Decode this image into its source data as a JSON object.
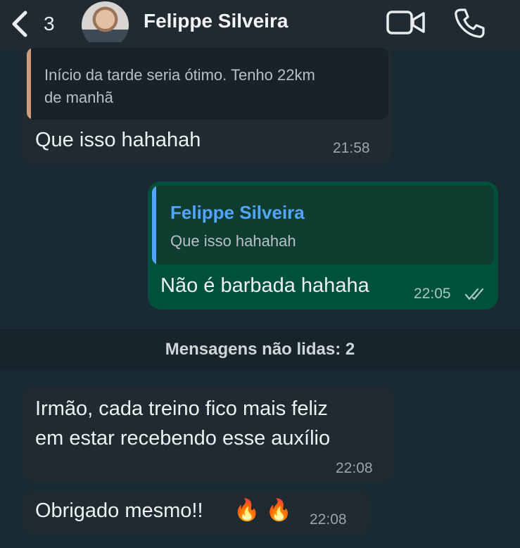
{
  "header": {
    "back_count": "3",
    "contact_name": "Felippe Silveira"
  },
  "messages": [
    {
      "quote_text_line1": "Início da tarde seria ótimo. Tenho 22km",
      "quote_text_line2": "de manhã",
      "text": "Que isso hahahah",
      "time": "21:58"
    },
    {
      "quote_author": "Felippe Silveira",
      "quote_text": "Que isso hahahah",
      "text": "Não é barbada hahaha",
      "time": "22:05"
    },
    {
      "text_line1": "Irmão, cada treino fico mais feliz",
      "text_line2": "em estar recebendo esse auxílio",
      "time": "22:08"
    },
    {
      "text": "Obrigado mesmo!!",
      "emoji": "🔥 🔥",
      "time": "22:08"
    }
  ],
  "unread_label": "Mensagens não lidas: 2",
  "colors": {
    "background": "#1a2a33",
    "incoming_bubble": "#1f2b31",
    "outgoing_bubble": "#00513b",
    "quote_author_blue": "#53a6ff"
  },
  "icons": [
    "chevron-left-icon",
    "video-call-icon",
    "phone-call-icon",
    "double-check-icon",
    "fire-emoji"
  ]
}
